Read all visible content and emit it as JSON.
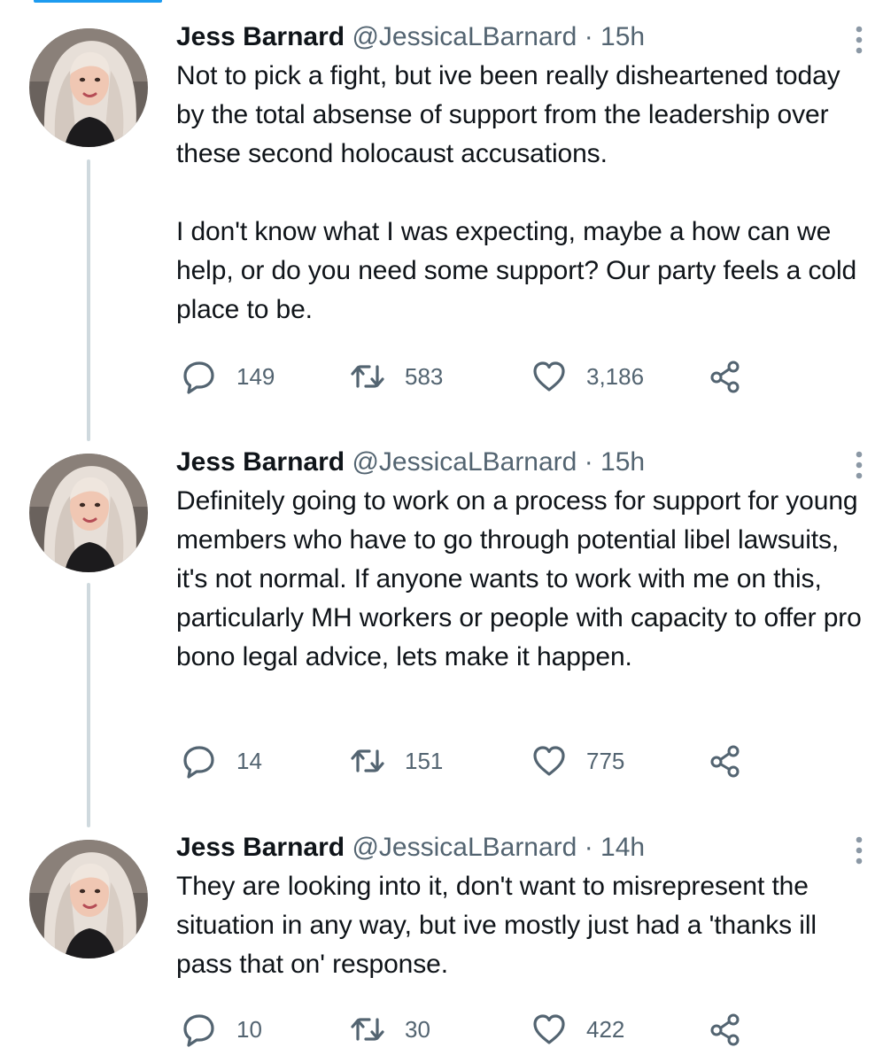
{
  "thread": {
    "tweets": [
      {
        "author_name": "Jess Barnard",
        "handle": "@JessicaLBarnard",
        "separator": "·",
        "time": "15h",
        "text": "Not to pick a fight, but ive been really disheartened today by the total absense of support from the leadership over these second holocaust accusations.\n\nI don't know what I was expecting, maybe a how can we help, or do you need some support? Our party feels a cold place to be.",
        "replies": "149",
        "retweets": "583",
        "likes": "3,186"
      },
      {
        "author_name": "Jess Barnard",
        "handle": "@JessicaLBarnard",
        "separator": "·",
        "time": "15h",
        "text": "Definitely going to work on a process for support for young members who have to go through potential libel lawsuits, it's not normal. If anyone wants to work with me on this, particularly MH workers or people with capacity to offer pro bono legal advice, lets make it happen.",
        "replies": "14",
        "retweets": "151",
        "likes": "775"
      },
      {
        "author_name": "Jess Barnard",
        "handle": "@JessicaLBarnard",
        "separator": "·",
        "time": "14h",
        "text": "They are looking into it, don't want to misrepresent the situation in any way, but ive mostly just had a 'thanks ill pass that on' response.",
        "replies": "10",
        "retweets": "30",
        "likes": "422"
      }
    ]
  },
  "icons": {
    "reply": "reply-icon",
    "retweet": "retweet-icon",
    "like": "heart-icon",
    "share": "share-icon",
    "more": "more-options-icon"
  },
  "colors": {
    "text_primary": "#0f1419",
    "text_secondary": "#536471",
    "thread_line": "#cfd9de",
    "accent": "#1d9bf0"
  }
}
